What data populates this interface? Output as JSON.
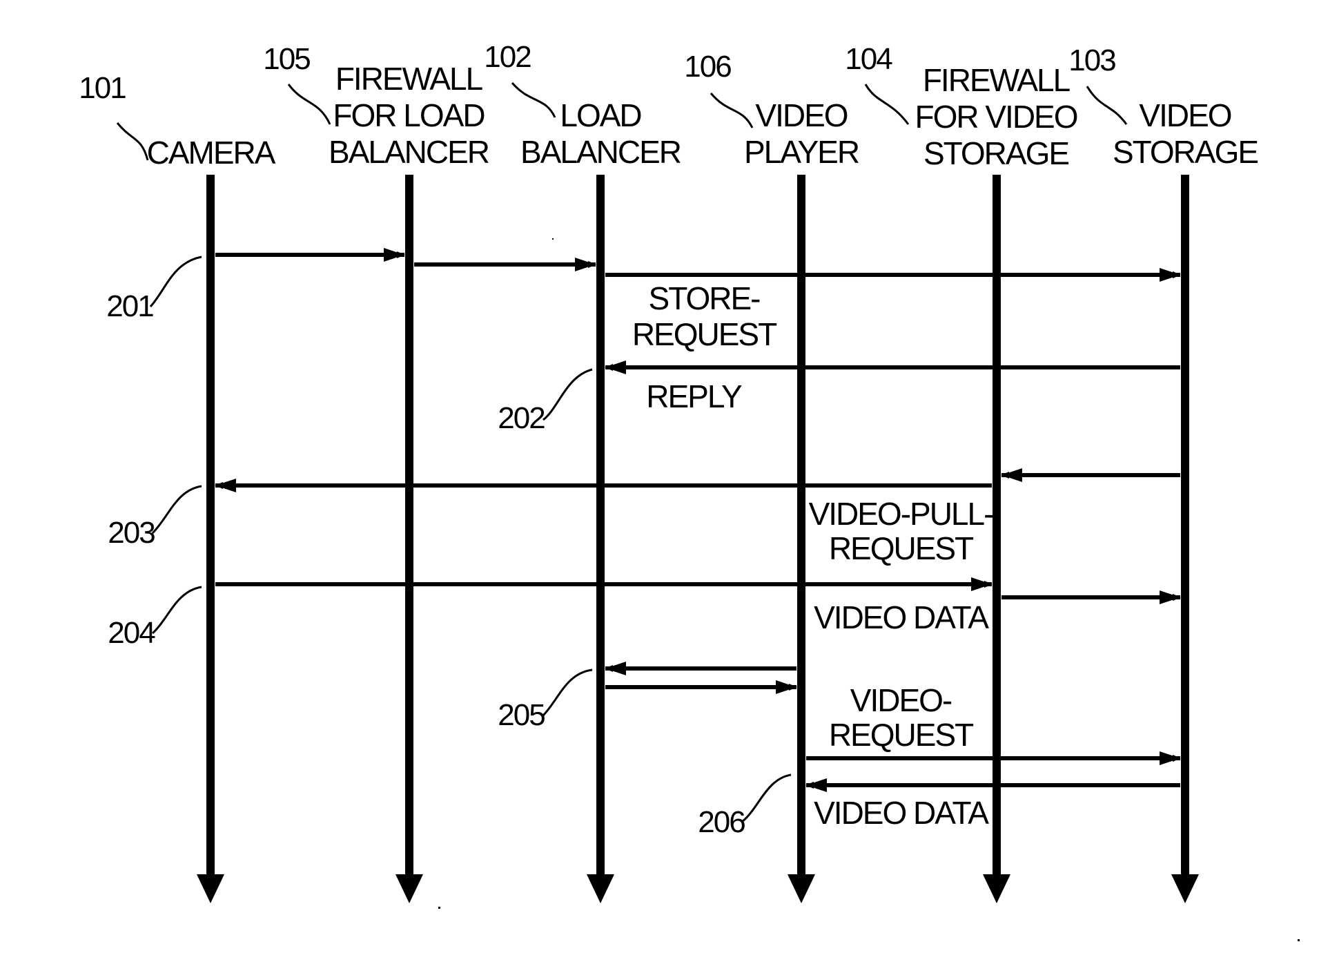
{
  "figure": {
    "participants": [
      {
        "id": "camera",
        "ref": "101",
        "label_lines": [
          "CAMERA"
        ]
      },
      {
        "id": "firewall_lb",
        "ref": "105",
        "label_lines": [
          "FIREWALL",
          "FOR LOAD",
          "BALANCER"
        ]
      },
      {
        "id": "load_balancer",
        "ref": "102",
        "label_lines": [
          "LOAD",
          "BALANCER"
        ]
      },
      {
        "id": "video_player",
        "ref": "106",
        "label_lines": [
          "VIDEO",
          "PLAYER"
        ]
      },
      {
        "id": "firewall_vs",
        "ref": "104",
        "label_lines": [
          "FIREWALL",
          "FOR VIDEO",
          "STORAGE"
        ]
      },
      {
        "id": "video_storage",
        "ref": "103",
        "label_lines": [
          "VIDEO",
          "STORAGE"
        ]
      }
    ],
    "steps": [
      {
        "ref": "201",
        "messages": [
          {
            "from": "camera",
            "to": "firewall_lb"
          },
          {
            "from": "firewall_lb",
            "to": "load_balancer"
          },
          {
            "from": "load_balancer",
            "to": "video_storage",
            "label_lines": [
              "STORE-",
              "REQUEST"
            ]
          }
        ]
      },
      {
        "ref": "202",
        "messages": [
          {
            "from": "video_storage",
            "to": "load_balancer",
            "label_lines": [
              "REPLY"
            ]
          }
        ]
      },
      {
        "ref": "203",
        "messages": [
          {
            "from": "video_storage",
            "to": "firewall_vs"
          },
          {
            "from": "firewall_vs",
            "to": "camera",
            "label_lines": [
              "VIDEO-PULL-",
              "REQUEST"
            ]
          }
        ]
      },
      {
        "ref": "204",
        "messages": [
          {
            "from": "camera",
            "to": "firewall_vs",
            "label_lines": [
              "VIDEO DATA"
            ]
          },
          {
            "from": "firewall_vs",
            "to": "video_storage"
          }
        ]
      },
      {
        "ref": "205",
        "messages": [
          {
            "from": "video_player",
            "to": "load_balancer"
          },
          {
            "from": "load_balancer",
            "to": "video_player"
          }
        ]
      },
      {
        "ref": "206",
        "messages": [
          {
            "from": "video_player",
            "to": "video_storage",
            "label_lines": [
              "VIDEO-",
              "REQUEST"
            ]
          },
          {
            "from": "video_storage",
            "to": "video_player",
            "label_lines": [
              "VIDEO DATA"
            ]
          }
        ]
      }
    ]
  }
}
